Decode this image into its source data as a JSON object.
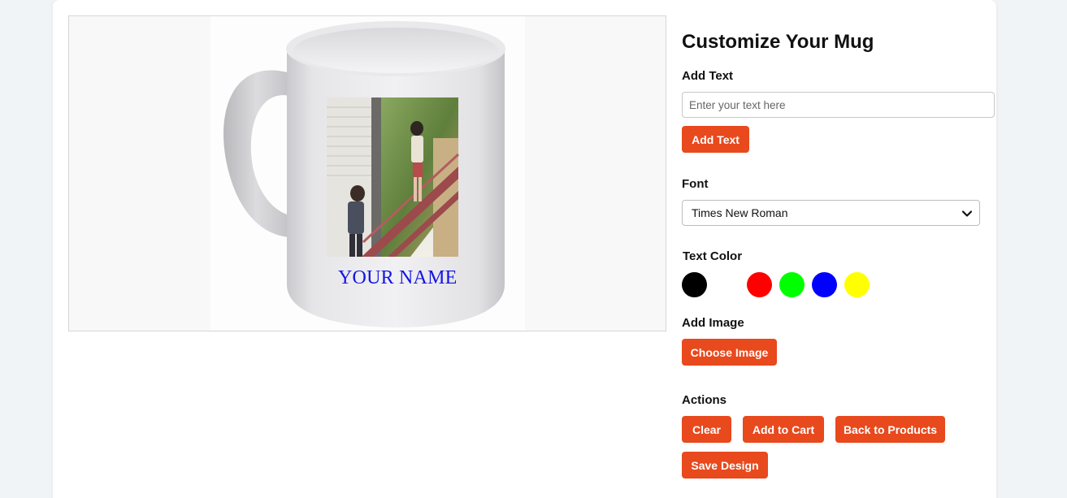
{
  "canvas": {
    "mug_text": "YOUR NAME",
    "mug_text_color": "#1414e6"
  },
  "panel": {
    "title": "Customize Your Mug",
    "add_text_label": "Add Text",
    "text_input_placeholder": "Enter your text here",
    "text_input_value": "",
    "add_text_button": "Add Text",
    "font_label": "Font",
    "font_selected": "Times New Roman",
    "text_color_label": "Text Color",
    "colors": [
      "#000000",
      "#ffffff",
      "#ff0000",
      "#00ff00",
      "#0000ff",
      "#ffff00"
    ],
    "add_image_label": "Add Image",
    "choose_image_button": "Choose Image",
    "actions_label": "Actions",
    "actions": {
      "clear": "Clear",
      "add_to_cart": "Add to Cart",
      "back_to_products": "Back to Products",
      "save_design": "Save Design"
    }
  },
  "theme": {
    "accent": "#e8491d"
  }
}
